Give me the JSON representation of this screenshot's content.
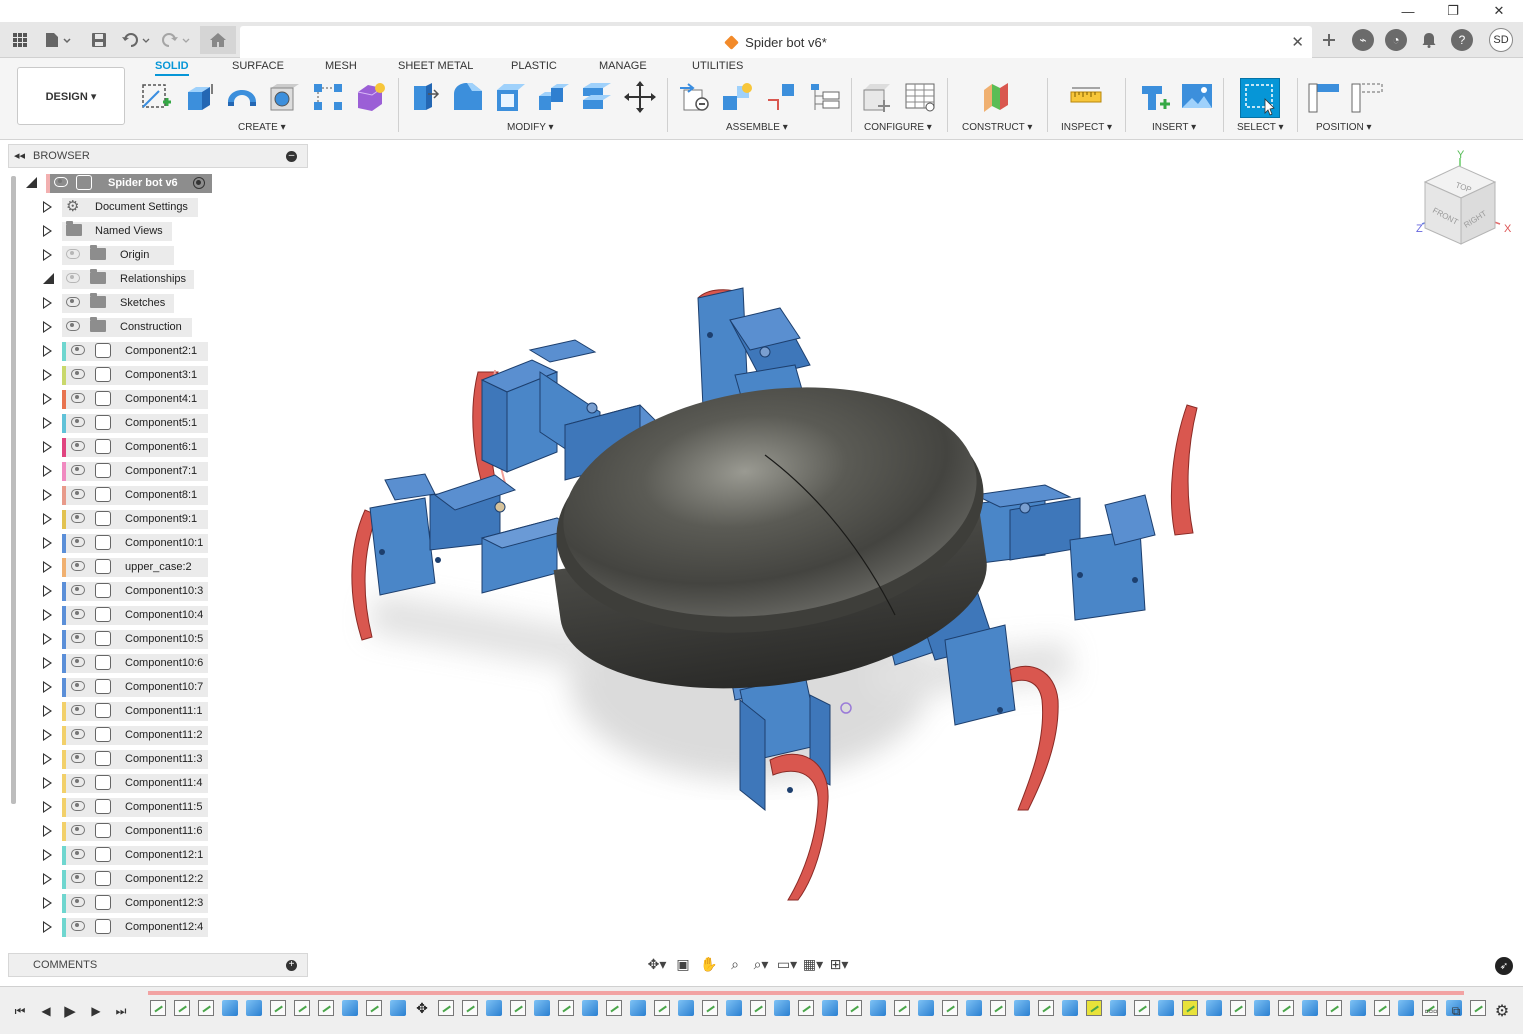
{
  "window": {
    "minimize": "—",
    "maximize": "❐",
    "close": "✕"
  },
  "appbar": {
    "document_title": "Spider bot v6*",
    "user_initials": "SD"
  },
  "toolbar": {
    "workspace": "DESIGN ▾",
    "tabs": [
      "SOLID",
      "SURFACE",
      "MESH",
      "SHEET METAL",
      "PLASTIC",
      "MANAGE",
      "UTILITIES"
    ],
    "active_tab": "SOLID",
    "groups": [
      "CREATE ▾",
      "MODIFY ▾",
      "ASSEMBLE ▾",
      "CONFIGURE ▾",
      "CONSTRUCT ▾",
      "INSPECT ▾",
      "INSERT ▾",
      "SELECT ▾",
      "POSITION ▾"
    ]
  },
  "browser": {
    "title": "BROWSER",
    "root": "Spider bot v6",
    "items": [
      {
        "label": "Document Settings",
        "kind": "settings"
      },
      {
        "label": "Named Views",
        "kind": "folder"
      },
      {
        "label": "Origin",
        "kind": "folder",
        "eye": "hidden"
      },
      {
        "label": "Relationships",
        "kind": "folder",
        "eye": "hidden"
      },
      {
        "label": "Sketches",
        "kind": "folder",
        "eye": "visible"
      },
      {
        "label": "Construction",
        "kind": "folder",
        "eye": "visible"
      },
      {
        "label": "Component2:1",
        "kind": "component",
        "color": "#6fd6cf"
      },
      {
        "label": "Component3:1",
        "kind": "component",
        "color": "#c9d86b"
      },
      {
        "label": "Component4:1",
        "kind": "component",
        "color": "#e8734f"
      },
      {
        "label": "Component5:1",
        "kind": "component",
        "color": "#60c2d8"
      },
      {
        "label": "Component6:1",
        "kind": "component",
        "color": "#e0447f"
      },
      {
        "label": "Component7:1",
        "kind": "component",
        "color": "#f08ac0"
      },
      {
        "label": "Component8:1",
        "kind": "component",
        "color": "#e89a8a"
      },
      {
        "label": "Component9:1",
        "kind": "component",
        "color": "#e2c250"
      },
      {
        "label": "Component10:1",
        "kind": "component",
        "color": "#5b8fd8"
      },
      {
        "label": "upper_case:2",
        "kind": "component",
        "color": "#f0b070"
      },
      {
        "label": "Component10:3",
        "kind": "component",
        "color": "#5b8fd8"
      },
      {
        "label": "Component10:4",
        "kind": "component",
        "color": "#5b8fd8"
      },
      {
        "label": "Component10:5",
        "kind": "component",
        "color": "#5b8fd8"
      },
      {
        "label": "Component10:6",
        "kind": "component",
        "color": "#5b8fd8"
      },
      {
        "label": "Component10:7",
        "kind": "component",
        "color": "#5b8fd8"
      },
      {
        "label": "Component11:1",
        "kind": "component",
        "color": "#f2d06a"
      },
      {
        "label": "Component11:2",
        "kind": "component",
        "color": "#f2d06a"
      },
      {
        "label": "Component11:3",
        "kind": "component",
        "color": "#f2d06a"
      },
      {
        "label": "Component11:4",
        "kind": "component",
        "color": "#f2d06a"
      },
      {
        "label": "Component11:5",
        "kind": "component",
        "color": "#f2d06a"
      },
      {
        "label": "Component11:6",
        "kind": "component",
        "color": "#f2d06a"
      },
      {
        "label": "Component12:1",
        "kind": "component",
        "color": "#6fd6cf"
      },
      {
        "label": "Component12:2",
        "kind": "component",
        "color": "#6fd6cf"
      },
      {
        "label": "Component12:3",
        "kind": "component",
        "color": "#6fd6cf"
      },
      {
        "label": "Component12:4",
        "kind": "component",
        "color": "#6fd6cf"
      }
    ]
  },
  "comments": {
    "title": "COMMENTS"
  },
  "viewcube": {
    "top": "TOP",
    "front": "FRONT",
    "right": "RIGHT",
    "axis_x": "X",
    "axis_y": "Y",
    "axis_z": "Z"
  },
  "colors": {
    "accent": "#0696d7",
    "leg_blue": "#4a86c8",
    "foot_red": "#d9574f",
    "shell": "#5a5a55"
  }
}
